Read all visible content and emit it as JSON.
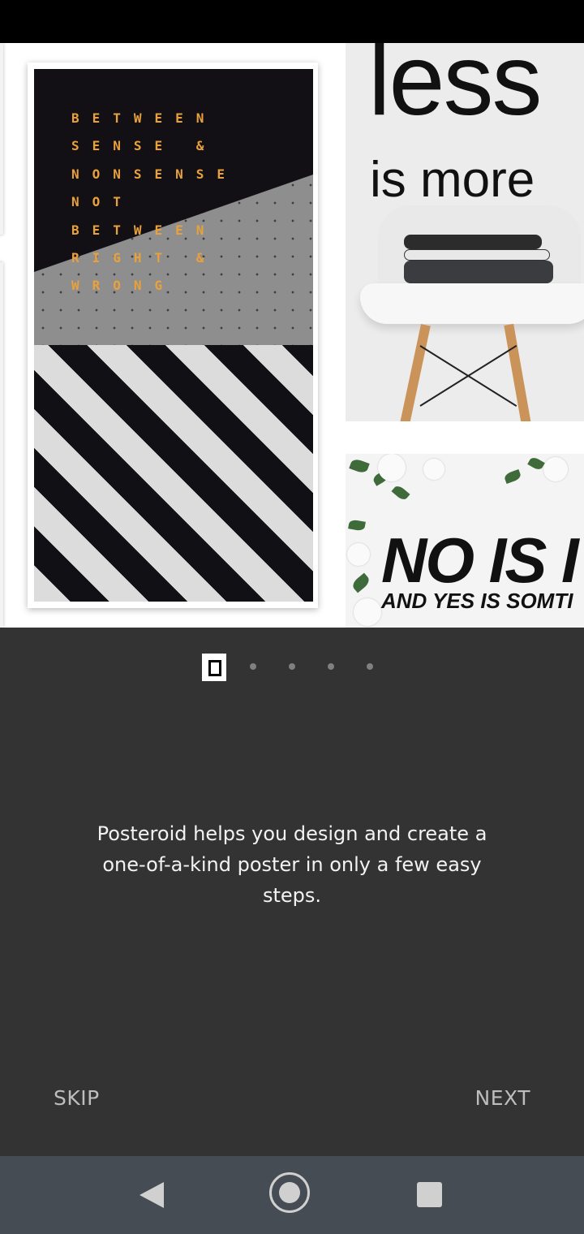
{
  "colors": {
    "background": "#333333",
    "accent_text": "#e9a13b",
    "nav_bar": "#464c53",
    "button_text": "#bdbdbd"
  },
  "gallery": {
    "poster_1": {
      "lines": [
        "BETWEEN",
        "SENSE &",
        "NONSENSE",
        "NOT",
        "BETWEEN",
        "RIGHT &",
        "WRONG"
      ]
    },
    "poster_2": {
      "word_large": "less",
      "word_small": "is more"
    },
    "poster_3": {
      "headline": "NO IS I",
      "subline": "AND YES IS SOMTI"
    }
  },
  "pager": {
    "total": 5,
    "current": 1
  },
  "description": "Posteroid helps you design and create a one-of-a-kind poster in only a few easy steps.",
  "actions": {
    "skip_label": "SKIP",
    "next_label": "NEXT"
  },
  "nav": {
    "back_icon": "back-triangle-icon",
    "home_icon": "home-circle-icon",
    "recents_icon": "recents-square-icon"
  }
}
